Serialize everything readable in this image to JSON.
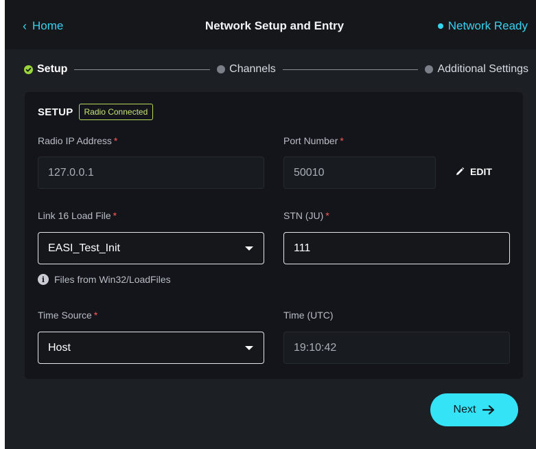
{
  "header": {
    "back_label": "Home",
    "title": "Network Setup and Entry",
    "status": "Network Ready"
  },
  "stepper": {
    "steps": [
      {
        "label": "Setup",
        "state": "complete"
      },
      {
        "label": "Channels",
        "state": "pending"
      },
      {
        "label": "Additional Settings",
        "state": "pending"
      }
    ]
  },
  "setup": {
    "title": "SETUP",
    "badge": "Radio Connected",
    "fields": {
      "radio_ip": {
        "label": "Radio IP Address",
        "required": "*",
        "value": "127.0.0.1"
      },
      "port": {
        "label": "Port Number",
        "required": "*",
        "value": "50010"
      },
      "load_file": {
        "label": "Link 16 Load File",
        "required": "*",
        "value": "EASI_Test_Init"
      },
      "stn": {
        "label": "STN (JU)",
        "required": "*",
        "value": "111"
      },
      "time_source": {
        "label": "Time Source",
        "required": "*",
        "value": "Host"
      },
      "time_utc": {
        "label": "Time (UTC)",
        "value": "19:10:42"
      }
    },
    "edit_label": "EDIT",
    "files_hint": "Files from Win32/LoadFiles"
  },
  "footer": {
    "next_label": "Next"
  },
  "colors": {
    "accent": "#38d2f0",
    "next_button": "#35e3f7",
    "complete": "#9ad63b",
    "required": "#ff5a5a",
    "badge": "#b9dc5a"
  }
}
